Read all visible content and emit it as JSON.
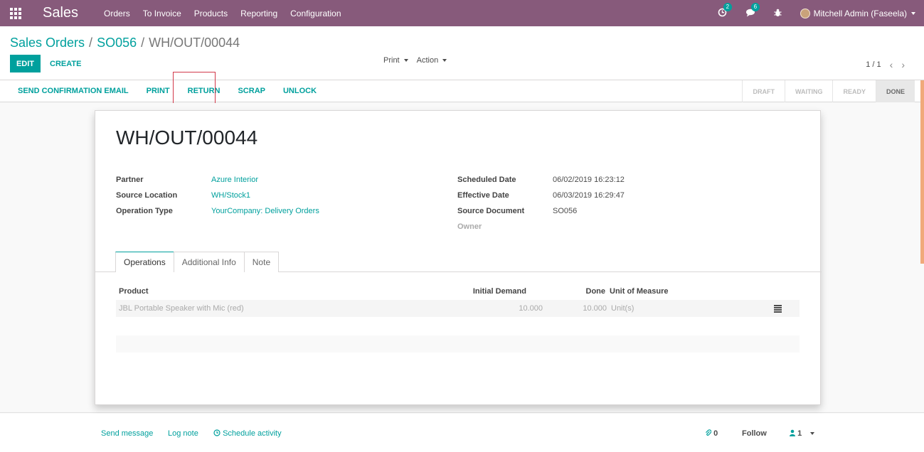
{
  "navbar": {
    "brand": "Sales",
    "menu": [
      "Orders",
      "To Invoice",
      "Products",
      "Reporting",
      "Configuration"
    ],
    "activity_count": "2",
    "message_count": "6",
    "user": "Mitchell Admin (Faseela)"
  },
  "breadcrumb": {
    "root": "Sales Orders",
    "parent": "SO056",
    "current": "WH/OUT/00044"
  },
  "buttons": {
    "edit": "EDIT",
    "create": "CREATE",
    "print": "Print",
    "action": "Action"
  },
  "pager": {
    "value": "1 / 1"
  },
  "statusbar": {
    "actions": [
      "SEND CONFIRMATION EMAIL",
      "PRINT",
      "RETURN",
      "SCRAP",
      "UNLOCK"
    ],
    "stages": [
      "DRAFT",
      "WAITING",
      "READY",
      "DONE"
    ],
    "current_stage": "DONE"
  },
  "record": {
    "title": "WH/OUT/00044",
    "left_fields": [
      {
        "label": "Partner",
        "value": "Azure Interior"
      },
      {
        "label": "Source Location",
        "value": "WH/Stock1"
      },
      {
        "label": "Operation Type",
        "value": "YourCompany: Delivery Orders"
      }
    ],
    "right_fields": [
      {
        "label": "Scheduled Date",
        "value": "06/02/2019 16:23:12"
      },
      {
        "label": "Effective Date",
        "value": "06/03/2019 16:29:47"
      },
      {
        "label": "Source Document",
        "value": "SO056"
      },
      {
        "label": "Owner",
        "value": ""
      }
    ]
  },
  "tabs": [
    "Operations",
    "Additional Info",
    "Note"
  ],
  "operations": {
    "columns": [
      "Product",
      "Initial Demand",
      "Done",
      "Unit of Measure"
    ],
    "rows": [
      {
        "product": "JBL Portable Speaker with Mic (red)",
        "initial_demand": "10.000",
        "done": "10.000",
        "uom": "Unit(s)"
      }
    ]
  },
  "chatter": {
    "send_message": "Send message",
    "log_note": "Log note",
    "schedule_activity": "Schedule activity",
    "attachments": "0",
    "follow": "Follow",
    "followers": "1"
  },
  "colors": {
    "navbar": "#875a7b",
    "accent": "#00a09d",
    "highlight_box": "#d2394a"
  }
}
